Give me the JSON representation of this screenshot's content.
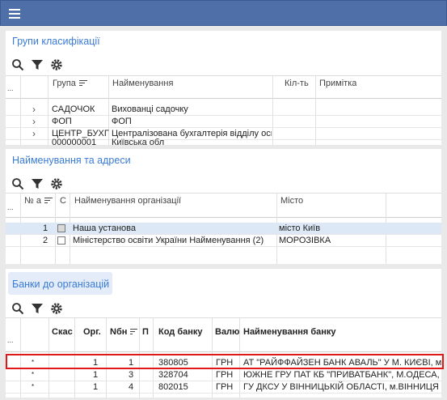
{
  "panels": {
    "groups": {
      "title": "Групи класифікації",
      "columns": [
        "...",
        "Група",
        "Найменування",
        "Кіл-ть",
        "Примітка"
      ],
      "rows": [
        {
          "group": "САДОЧОК",
          "name": "Вихованці садочку"
        },
        {
          "group": "ФОП",
          "name": "ФОП"
        },
        {
          "group": "ЦЕНТР_БУХГ",
          "name": "Централізована бухгалтерія відділу освіт"
        },
        {
          "group": "000000001",
          "name": "Київська обл"
        }
      ]
    },
    "names": {
      "title": "Найменування та адреси",
      "columns": [
        "...",
        "№ а",
        "С",
        "Найменування організації",
        "Місто"
      ],
      "rows": [
        {
          "num": "1",
          "checked": true,
          "name": "Наша установа",
          "city": "місто Київ"
        },
        {
          "num": "2",
          "checked": false,
          "name": "Міністерство освіти України Найменування (2)",
          "city": "МОРОЗІВКА"
        }
      ]
    },
    "banks": {
      "title": "Банки до організацій",
      "columns": [
        "...",
        "Скас",
        "Орг.",
        "Nбн",
        "П",
        "Код банку",
        "Валю",
        "Найменування банку"
      ],
      "rows": [
        {
          "mark": "*",
          "org": "1",
          "nbn": "1",
          "code": "380805",
          "cur": "ГРН",
          "bank": "АТ \"РАЙФФАЙЗЕН БАНК АВАЛЬ\" У М. КИЄВІ, м.Київ"
        },
        {
          "mark": "*",
          "org": "1",
          "nbn": "3",
          "code": "328704",
          "cur": "ГРН",
          "bank": "ЮЖНЕ ГРУ ПАТ КБ \"ПРИВАТБАНК\", М.ОДЕСА, м.Оде"
        },
        {
          "mark": "*",
          "org": "1",
          "nbn": "4",
          "code": "802015",
          "cur": "ГРН",
          "bank": "ГУ ДКСУ У ВІННИЦЬКІЙ ОБЛАСТІ, м.ВІННИЦЯ"
        }
      ]
    }
  },
  "icons": [
    "menu-icon",
    "search-icon",
    "filter-icon",
    "gear-icon",
    "chevron-right-icon",
    "checkbox-icon",
    "sort-icon"
  ],
  "colors": {
    "topbar": "#4f6fa8",
    "title": "#3a7bd5",
    "highlight": "#e01818",
    "selected_row": "#dce8f6"
  }
}
